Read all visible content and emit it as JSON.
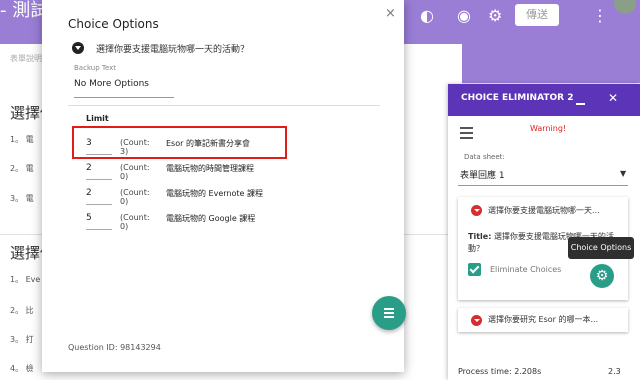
{
  "app": {
    "title_fragment": "- 測試 -",
    "send_label": "傳送"
  },
  "form": {
    "description": "表單說明",
    "questions": [
      {
        "title": "選擇你",
        "options": [
          "1。 電",
          "2。 電",
          "3。 電"
        ]
      },
      {
        "title": "選擇你",
        "options": [
          "1。 Eve",
          "2。 比",
          "3。 打",
          "4。 檢"
        ]
      }
    ]
  },
  "dialog": {
    "title": "Choice Options",
    "close": "×",
    "question": "選擇你要支援電腦玩物哪一天的活動？",
    "backup_label": "Backup Text",
    "backup_value": "No More Options",
    "limit_header": "Limit",
    "rows": [
      {
        "limit": "3",
        "count": "(Count: 3)",
        "name": "Esor 的筆記新書分享會"
      },
      {
        "limit": "2",
        "count": "(Count: 0)",
        "name": "電腦玩物的時間管理課程"
      },
      {
        "limit": "2",
        "count": "(Count: 0)",
        "name": "電腦玩物的 Evernote 課程"
      },
      {
        "limit": "5",
        "count": "(Count: 0)",
        "name": "電腦玩物的 Google 課程"
      }
    ],
    "question_id": "Question ID: 98143294"
  },
  "sidebar": {
    "title": "CHOICE ELIMINATOR 2",
    "warning": "Warning!",
    "data_sheet_label": "Data sheet:",
    "data_sheet_value": "表單回應 1",
    "card1_title": "選擇你要支援電腦玩物哪一天...",
    "card1_detail_label": "Title:",
    "card1_detail_text": "選擇你要支援電腦玩物哪一天的活動？",
    "eliminate_label": "Eliminate Choices",
    "card2_title": "選擇你要研究 Esor 的哪一本...",
    "process_time": "Process time: 2.208s",
    "version": "2.3"
  },
  "tooltip": {
    "text": "Choice Options"
  }
}
